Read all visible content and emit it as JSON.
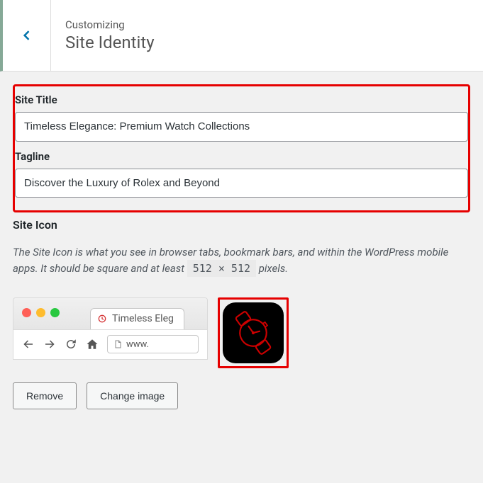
{
  "header": {
    "breadcrumb": "Customizing",
    "title": "Site Identity"
  },
  "fields": {
    "site_title": {
      "label": "Site Title",
      "value": "Timeless Elegance: Premium Watch Collections"
    },
    "tagline": {
      "label": "Tagline",
      "value": "Discover the Luxury of Rolex and Beyond"
    }
  },
  "site_icon": {
    "section_label": "Site Icon",
    "desc_before": "The Site Icon is what you see in browser tabs, bookmark bars, and within the WordPress mobile apps. It should be square and at least ",
    "dimensions": "512 × 512",
    "desc_after": " pixels."
  },
  "browser_preview": {
    "tab_text": "Timeless Eleg",
    "url_text": "www."
  },
  "buttons": {
    "remove": "Remove",
    "change": "Change image"
  }
}
